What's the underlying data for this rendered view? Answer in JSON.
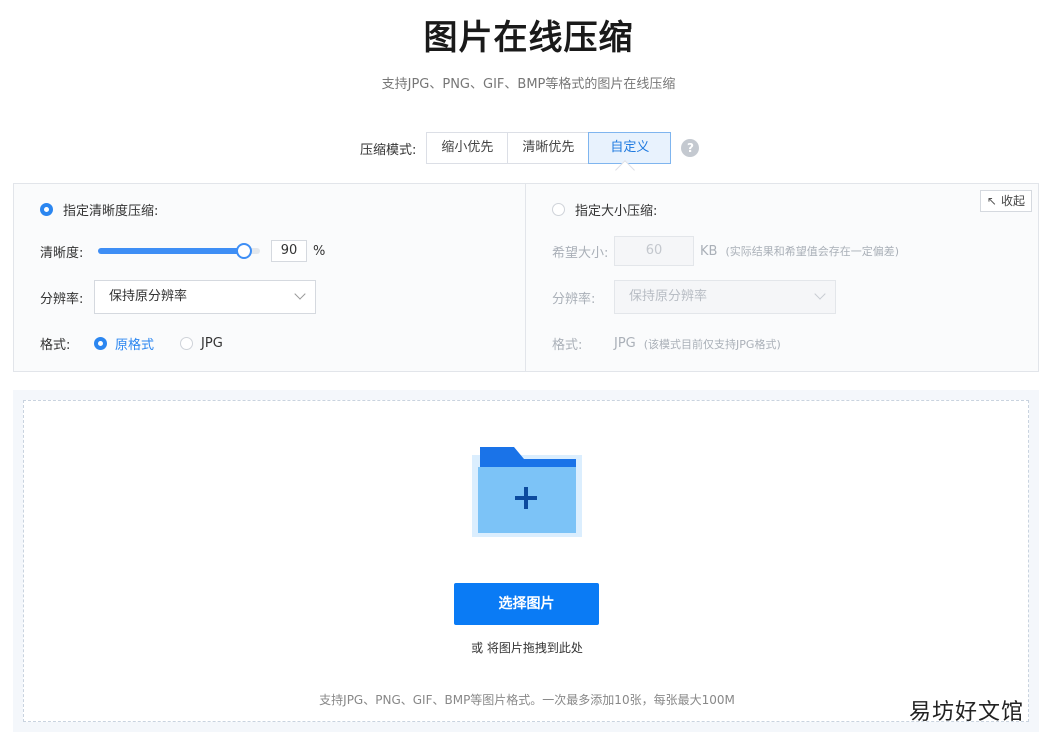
{
  "header": {
    "title": "图片在线压缩",
    "subtitle": "支持JPG、PNG、GIF、BMP等格式的图片在线压缩"
  },
  "mode": {
    "label": "压缩模式:",
    "options": [
      "缩小优先",
      "清晰优先",
      "自定义"
    ],
    "selected": "自定义",
    "help_icon": "question-circle-icon"
  },
  "collapse": {
    "label": "收起",
    "icon": "arrow-up-left-icon"
  },
  "clarity_mode": {
    "label": "指定清晰度压缩:",
    "checked": true,
    "clarity_label": "清晰度:",
    "clarity_value": "90",
    "clarity_fraction": 0.9,
    "clarity_unit": "%",
    "resolution_label": "分辨率:",
    "resolution_value": "保持原分辨率",
    "format_label": "格式:",
    "format_options": [
      "原格式",
      "JPG"
    ],
    "format_selected": "原格式"
  },
  "size_mode": {
    "label": "指定大小压缩:",
    "checked": false,
    "size_label": "希望大小:",
    "size_value": "60",
    "size_unit": "KB",
    "size_hint": "(实际结果和希望值会存在一定偏差)",
    "resolution_label": "分辨率:",
    "resolution_value": "保持原分辨率",
    "format_label": "格式:",
    "format_value": "JPG",
    "format_hint": "(该模式目前仅支持JPG格式)"
  },
  "upload": {
    "folder_icon": "folder-plus-icon",
    "choose_label": "选择图片",
    "or_text": "或 将图片拖拽到此处",
    "support_text": "支持JPG、PNG、GIF、BMP等图片格式。一次最多添加10张，每张最大100M"
  },
  "watermark": "易坊好文馆",
  "colors": {
    "accent": "#0a7bf5",
    "slider": "#3e8ef5",
    "selected_segment_bg": "#e8f2fd"
  }
}
